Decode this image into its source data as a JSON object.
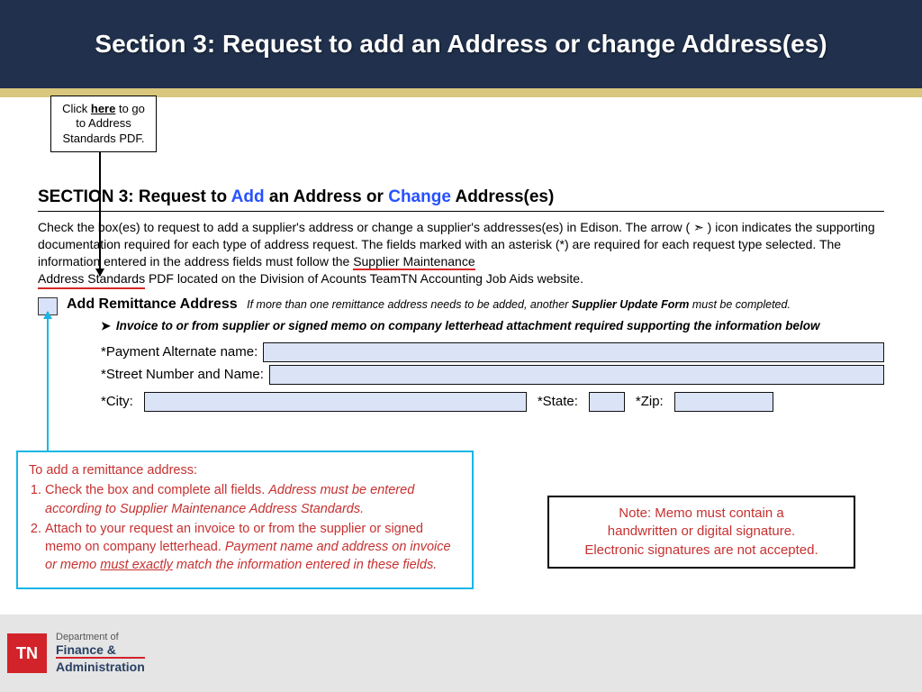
{
  "banner": {
    "title": "Section 3: Request to add an Address or change Address(es)"
  },
  "callout_top": {
    "pre": "Click ",
    "link": "here",
    "post": " to go to Address Standards PDF."
  },
  "section": {
    "prefix": "SECTION 3: Request to ",
    "add": "Add",
    "mid": " an Address or ",
    "change": "Change",
    "suffix": " Address(es)"
  },
  "para": {
    "p1a": "Check the box(es) to request to add a supplier's address or change a supplier's addresses(es) in Edison. The arrow ( ",
    "arrowchar": "➣",
    "p1b": " ) icon indicates the supporting documentation required for each type of address request. The fields marked with an asterisk (*) are required for each request type selected. The information entered in the address fields must follow the ",
    "underlined1": "Supplier Maintenance",
    "underlined2": "Address Standards",
    "p1c": " PDF located on the Division of Acounts TeamTN Accounting Job Aids website."
  },
  "add_block": {
    "title": "Add Remittance Address",
    "note_pre": "If more than one remittance address needs to be added, another ",
    "note_bold": "Supplier Update Form",
    "note_post": " must be completed.",
    "invoice": "Invoice to or from supplier or signed memo on company letterhead attachment required supporting the information below"
  },
  "fields": {
    "pay_label": "*Payment Alternate name:",
    "street_label": "*Street Number and Name:",
    "city_label": "*City:",
    "state_label": "*State:",
    "zip_label": "*Zip:"
  },
  "callout_left": {
    "lead": "To add a remittance address:",
    "li1a": "Check the box and complete all fields. ",
    "li1b": "Address must be entered according to Supplier Maintenance Address Standards.",
    "li2a": "Attach to your request an invoice to or from the supplier or signed memo on company letterhead. ",
    "li2b_pre": "Payment name and address on invoice or memo ",
    "li2b_u": "must exactly",
    "li2b_post": " match the information entered in these fields."
  },
  "note_box": {
    "l1": "Note: Memo must contain a",
    "l2": "handwritten or digital signature.",
    "l3": "Electronic signatures are not accepted."
  },
  "footer": {
    "badge": "TN",
    "d1": "Department of",
    "d2": "Finance &",
    "d3": "Administration"
  }
}
